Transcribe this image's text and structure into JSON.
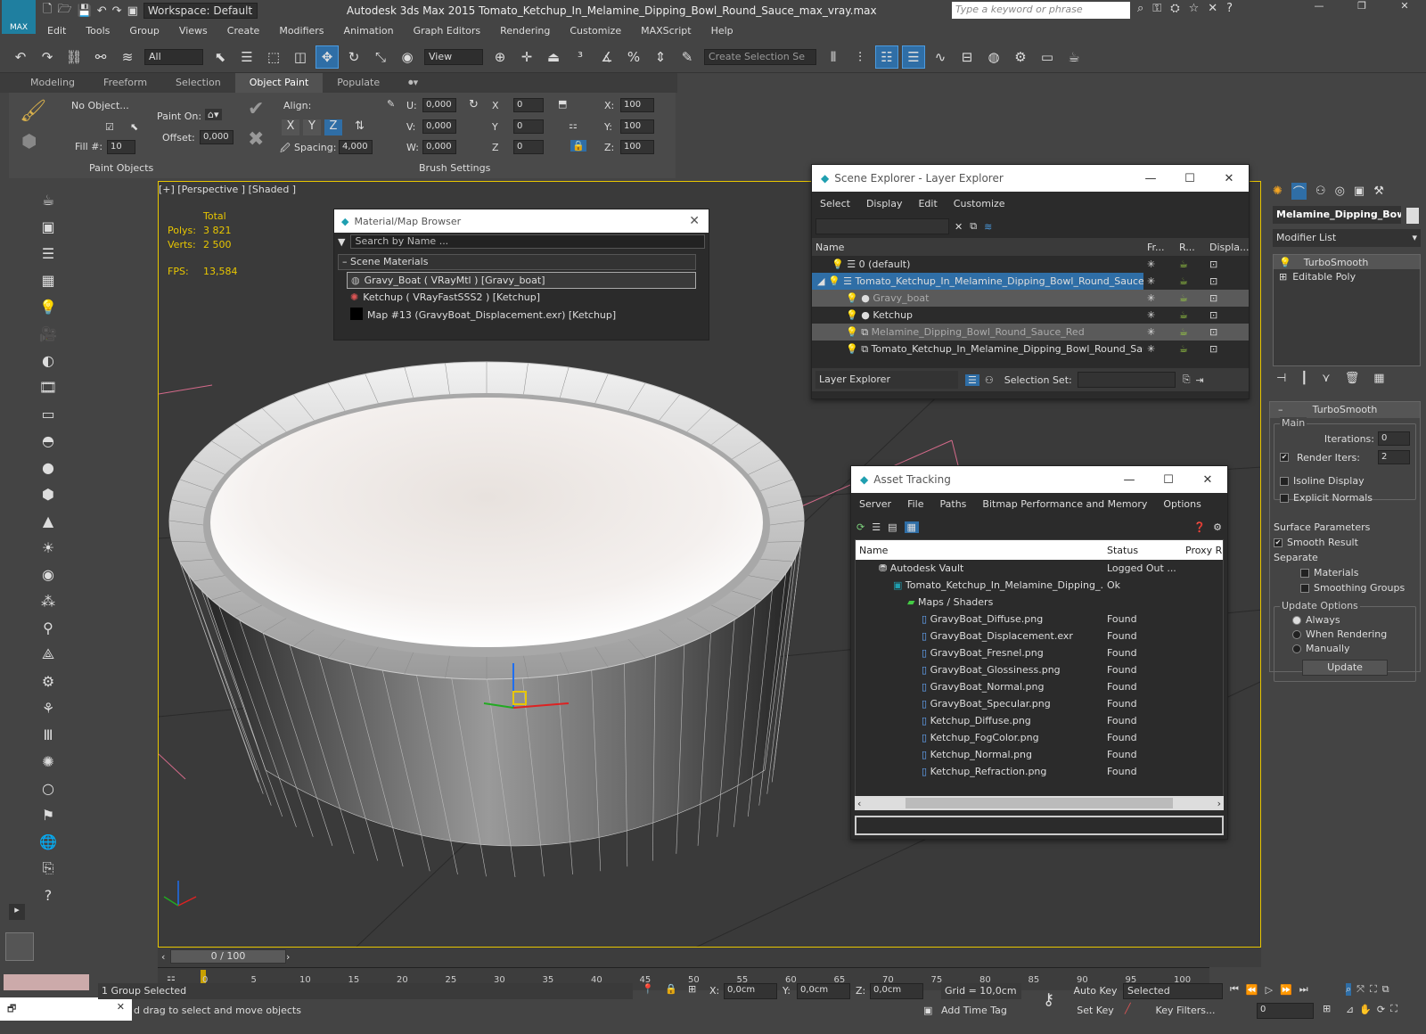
{
  "titlebar": {
    "app_icon": "MAX",
    "workspace": "Workspace: Default",
    "title": "Autodesk 3ds Max  2015     Tomato_Ketchup_In_Melamine_Dipping_Bowl_Round_Sauce_max_vray.max",
    "search_placeholder": "Type a keyword or phrase"
  },
  "menu": [
    "Edit",
    "Tools",
    "Group",
    "Views",
    "Create",
    "Modifiers",
    "Animation",
    "Graph Editors",
    "Rendering",
    "Customize",
    "MAXScript",
    "Help"
  ],
  "toolbar": {
    "selection_filter": "All",
    "ref_coord": "View",
    "named_selection": "Create Selection Se"
  },
  "ribbon": {
    "tabs": [
      "Modeling",
      "Freeform",
      "Selection",
      "Object Paint",
      "Populate"
    ],
    "active_tab": "Object Paint",
    "no_object": "No Object...",
    "fill_label": "Fill #:",
    "fill_value": "10",
    "paint_on": "Paint On:",
    "offset_label": "Offset:",
    "offset_value": "0,000",
    "align_label": "Align:",
    "axes": [
      "X",
      "Y",
      "Z"
    ],
    "spacing_label": "Spacing:",
    "spacing_value": "4,000",
    "u_label": "U:",
    "u_value": "0,000",
    "v_label": "V:",
    "v_value": "0,000",
    "w_label": "W:",
    "w_value": "0,000",
    "rx_label": "X",
    "rx_value": "0",
    "ry_label": "Y",
    "ry_value": "0",
    "rz_label": "Z",
    "rz_value": "0",
    "sx_label": "X:",
    "sx_value": "100",
    "sy_label": "Y:",
    "sy_value": "100",
    "sz_label": "Z:",
    "sz_value": "100",
    "paint_objects": "Paint Objects",
    "brush_settings": "Brush Settings"
  },
  "viewport": {
    "label": "[+] [Perspective ] [Shaded ]",
    "stats_total": "Total",
    "polys_label": "Polys:",
    "polys_value": "3 821",
    "verts_label": "Verts:",
    "verts_value": "2 500",
    "fps_label": "FPS:",
    "fps_value": "13,584"
  },
  "material_browser": {
    "title": "Material/Map Browser",
    "search_placeholder": "Search by Name ...",
    "section": "Scene Materials",
    "items": [
      "Gravy_Boat  ( VRayMtl )  [Gravy_boat]",
      "Ketchup  ( VRayFastSSS2 )  [Ketchup]",
      "Map #13 (GravyBoat_Displacement.exr)  [Ketchup]"
    ]
  },
  "scene_explorer": {
    "title": "Scene Explorer - Layer Explorer",
    "menu": [
      "Select",
      "Display",
      "Edit",
      "Customize"
    ],
    "columns": [
      "Name",
      "Fr...",
      "R...",
      "Displa..."
    ],
    "rows": [
      {
        "name": "0 (default)",
        "level": 0
      },
      {
        "name": "Tomato_Ketchup_In_Melamine_Dipping_Bowl_Round_Sauce",
        "level": 0
      },
      {
        "name": "Gravy_boat",
        "level": 1
      },
      {
        "name": "Ketchup",
        "level": 1
      },
      {
        "name": "Melamine_Dipping_Bowl_Round_Sauce_Red",
        "level": 1
      },
      {
        "name": "Tomato_Ketchup_In_Melamine_Dipping_Bowl_Round_Sauce",
        "level": 1
      }
    ],
    "footer_label": "Layer Explorer",
    "selection_set": "Selection Set:"
  },
  "asset_tracking": {
    "title": "Asset Tracking",
    "menu": [
      "Server",
      "File",
      "Paths",
      "Bitmap Performance and Memory",
      "Options"
    ],
    "columns": [
      "Name",
      "Status",
      "Proxy R"
    ],
    "rows": [
      {
        "name": "Autodesk Vault",
        "status": "Logged Out ...",
        "indent": 1
      },
      {
        "name": "Tomato_Ketchup_In_Melamine_Dipping_...",
        "status": "Ok",
        "indent": 2
      },
      {
        "name": "Maps / Shaders",
        "status": "",
        "indent": 3
      },
      {
        "name": "GravyBoat_Diffuse.png",
        "status": "Found",
        "indent": 4
      },
      {
        "name": "GravyBoat_Displacement.exr",
        "status": "Found",
        "indent": 4
      },
      {
        "name": "GravyBoat_Fresnel.png",
        "status": "Found",
        "indent": 4
      },
      {
        "name": "GravyBoat_Glossiness.png",
        "status": "Found",
        "indent": 4
      },
      {
        "name": "GravyBoat_Normal.png",
        "status": "Found",
        "indent": 4
      },
      {
        "name": "GravyBoat_Specular.png",
        "status": "Found",
        "indent": 4
      },
      {
        "name": "Ketchup_Diffuse.png",
        "status": "Found",
        "indent": 4
      },
      {
        "name": "Ketchup_FogColor.png",
        "status": "Found",
        "indent": 4
      },
      {
        "name": "Ketchup_Normal.png",
        "status": "Found",
        "indent": 4
      },
      {
        "name": "Ketchup_Refraction.png",
        "status": "Found",
        "indent": 4
      }
    ]
  },
  "command_panel": {
    "object_name": "Melamine_Dipping_Bowl_",
    "modifier_list": "Modifier List",
    "stack": [
      "TurboSmooth",
      "Editable Poly"
    ],
    "rollout_title": "TurboSmooth",
    "main": "Main",
    "iterations_label": "Iterations:",
    "iterations_value": "0",
    "render_iters_label": "Render Iters:",
    "render_iters_value": "2",
    "isoline": "Isoline Display",
    "explicit_normals": "Explicit Normals",
    "surface_params": "Surface Parameters",
    "smooth_result": "Smooth Result",
    "separate": "Separate",
    "materials": "Materials",
    "smoothing_groups": "Smoothing Groups",
    "update_options": "Update Options",
    "always": "Always",
    "when_rendering": "When Rendering",
    "manually": "Manually",
    "update_button": "Update"
  },
  "timeline": {
    "frame": "0 / 100",
    "ticks": [
      "0",
      "5",
      "10",
      "15",
      "20",
      "25",
      "30",
      "35",
      "40",
      "45",
      "50",
      "55",
      "60",
      "65",
      "70",
      "75",
      "80",
      "85",
      "90",
      "95",
      "100"
    ]
  },
  "status": {
    "selected": "1 Group Selected",
    "prompt": "d drag to select and move objects",
    "x_label": "X:",
    "x_value": "0,0cm",
    "y_label": "Y:",
    "y_value": "0,0cm",
    "z_label": "Z:",
    "z_value": "0,0cm",
    "grid": "Grid = 10,0cm",
    "auto_key": "Auto Key",
    "set_key": "Set Key",
    "selected_dropdown": "Selected",
    "key_filters": "Key Filters...",
    "add_time_tag": "Add Time Tag",
    "frame_value": "0"
  }
}
